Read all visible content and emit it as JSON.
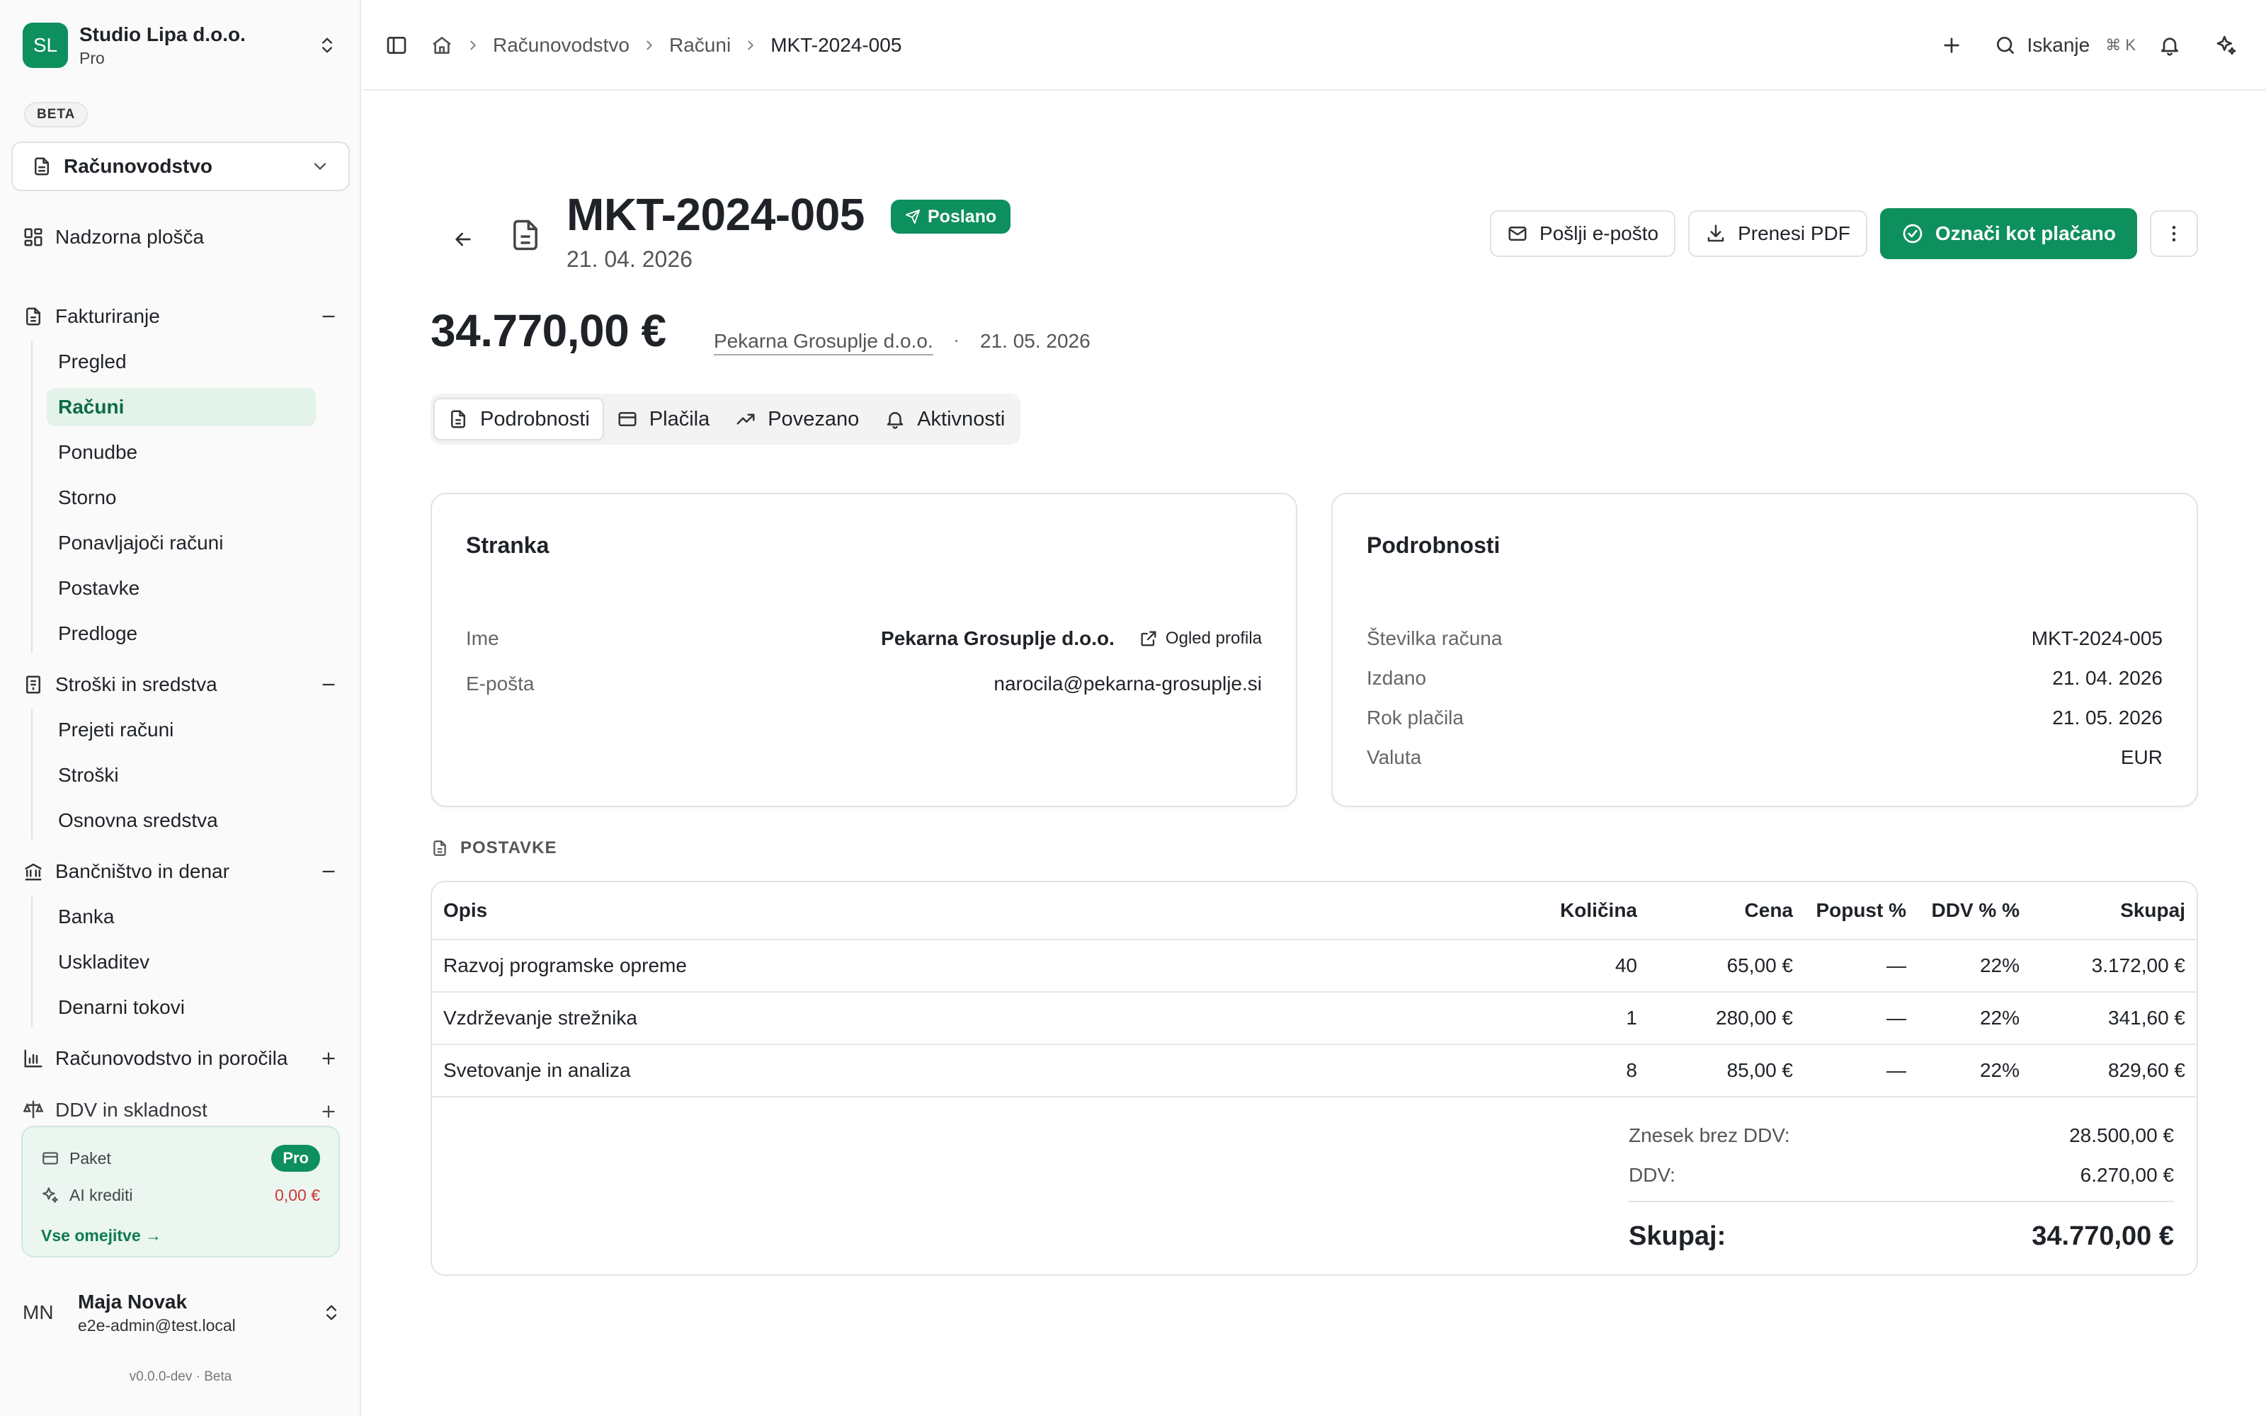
{
  "colors": {
    "accent": "#0e8f5e",
    "accent_light": "#e4f3ea",
    "danger": "#d13838"
  },
  "org": {
    "initials": "SL",
    "name": "Studio Lipa d.o.o.",
    "plan": "Pro"
  },
  "sidebar": {
    "beta_label": "BETA",
    "module": "Računovodstvo",
    "dashboard": "Nadzorna plošča",
    "groups": [
      {
        "label": "Fakturiranje",
        "items": [
          "Pregled",
          "Računi",
          "Ponudbe",
          "Storno",
          "Ponavljajoči računi",
          "Postavke",
          "Predloge"
        ]
      },
      {
        "label": "Stroški in sredstva",
        "items": [
          "Prejeti računi",
          "Stroški",
          "Osnovna sredstva"
        ]
      },
      {
        "label": "Bančništvo in denar",
        "items": [
          "Banka",
          "Uskladitev",
          "Denarni tokovi"
        ]
      },
      {
        "label": "Računovodstvo in poročila",
        "items": []
      },
      {
        "label": "DDV in skladnost",
        "items": []
      }
    ],
    "plan_card": {
      "package_label": "Paket",
      "package_value": "Pro",
      "credits_label": "AI krediti",
      "credits_value": "0,00 €",
      "link": "Vse omejitve →"
    },
    "user": {
      "initials": "MN",
      "name": "Maja Novak",
      "email": "e2e-admin@test.local"
    },
    "version": "v0.0.0-dev · Beta"
  },
  "topbar": {
    "breadcrumbs": [
      "Računovodstvo",
      "Računi",
      "MKT-2024-005"
    ],
    "search_label": "Iskanje",
    "search_kbd": "⌘   K"
  },
  "invoice": {
    "number": "MKT-2024-005",
    "status": "Poslano",
    "issue_date": "21. 04. 2026",
    "amount": "34.770,00 €",
    "customer": "Pekarna Grosuplje d.o.o.",
    "due_date": "21. 05. 2026",
    "actions": {
      "email": "Pošlji e-pošto",
      "pdf": "Prenesi PDF",
      "mark_paid": "Označi kot plačano"
    },
    "tabs": [
      "Podrobnosti",
      "Plačila",
      "Povezano",
      "Aktivnosti"
    ]
  },
  "customer_card": {
    "title": "Stranka",
    "name_label": "Ime",
    "name_value": "Pekarna Grosuplje d.o.o.",
    "profile_link": "Ogled profila",
    "email_label": "E-pošta",
    "email_value": "narocila@pekarna-grosuplje.si"
  },
  "details_card": {
    "title": "Podrobnosti",
    "rows": [
      {
        "label": "Številka računa",
        "value": "MKT-2024-005"
      },
      {
        "label": "Izdano",
        "value": "21. 04. 2026"
      },
      {
        "label": "Rok plačila",
        "value": "21. 05. 2026"
      },
      {
        "label": "Valuta",
        "value": "EUR"
      }
    ]
  },
  "items": {
    "section_title": "POSTAVKE",
    "columns": [
      "Opis",
      "Količina",
      "Cena",
      "Popust %",
      "DDV % %",
      "Skupaj"
    ],
    "rows": [
      [
        "Razvoj programske opreme",
        "40",
        "65,00 €",
        "—",
        "22%",
        "3.172,00 €"
      ],
      [
        "Vzdrževanje strežnika",
        "1",
        "280,00 €",
        "—",
        "22%",
        "341,60 €"
      ],
      [
        "Svetovanje in analiza",
        "8",
        "85,00 €",
        "—",
        "22%",
        "829,60 €"
      ]
    ],
    "totals": {
      "net_label": "Znesek brez DDV:",
      "net_value": "28.500,00 €",
      "vat_label": "DDV:",
      "vat_value": "6.270,00 €",
      "total_label": "Skupaj:",
      "total_value": "34.770,00 €"
    }
  }
}
